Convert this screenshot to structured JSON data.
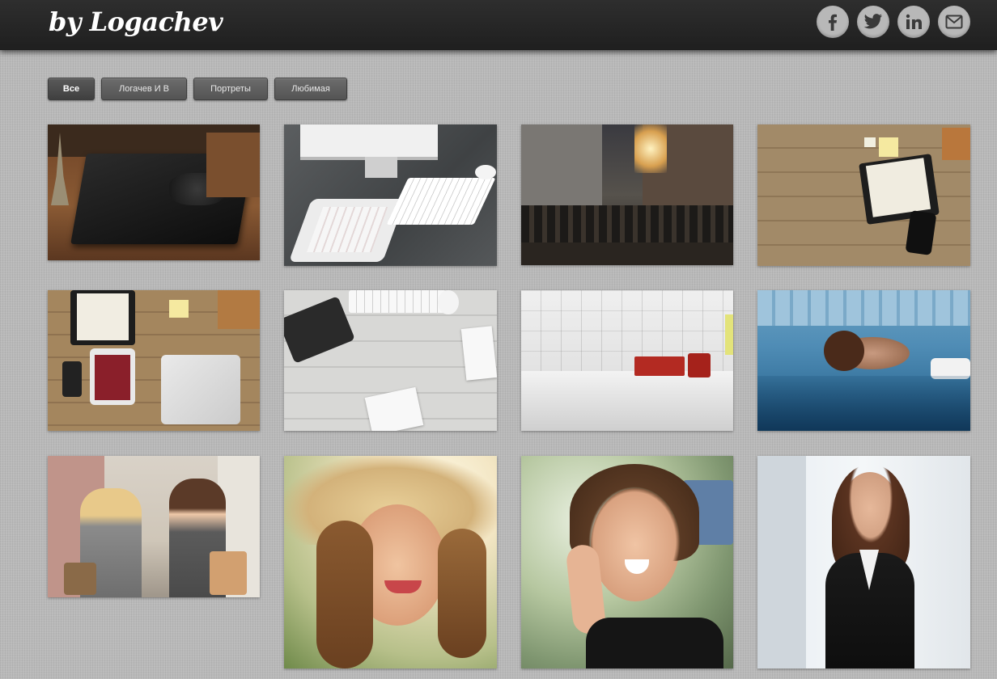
{
  "header": {
    "logo": "by Logachev",
    "social_links": [
      {
        "name": "facebook-icon",
        "glyph": "f"
      },
      {
        "name": "twitter-icon",
        "glyph": "bird"
      },
      {
        "name": "linkedin-icon",
        "glyph": "in"
      },
      {
        "name": "mail-icon",
        "glyph": "envelope"
      }
    ]
  },
  "filters": {
    "items": [
      "Все",
      "Логачев И В",
      "Портреты",
      "Любимая"
    ],
    "active": "Все"
  },
  "gallery": {
    "photos": [
      {
        "subject": "crocodile-leather-wallet"
      },
      {
        "subject": "tablet-keyboard-imac-desk"
      },
      {
        "subject": "city-street-crowd-sunset"
      },
      {
        "subject": "organizer-on-wooden-table"
      },
      {
        "subject": "desk-flatlay-laptop-tablet"
      },
      {
        "subject": "white-desk-tablet-keyboard"
      },
      {
        "subject": "interior-sketch-red-sofa"
      },
      {
        "subject": "woman-floating-in-pool"
      },
      {
        "subject": "two-women-shopping"
      },
      {
        "subject": "woman-in-straw-hat"
      },
      {
        "subject": "woman-selfie-peace-sign"
      },
      {
        "subject": "businesswoman-portrait"
      }
    ]
  },
  "colors": {
    "header_bg": "#262626",
    "social_circle": "#b8b8b8",
    "button_bg": "#606060",
    "page_bg": "#b9b9b9"
  }
}
